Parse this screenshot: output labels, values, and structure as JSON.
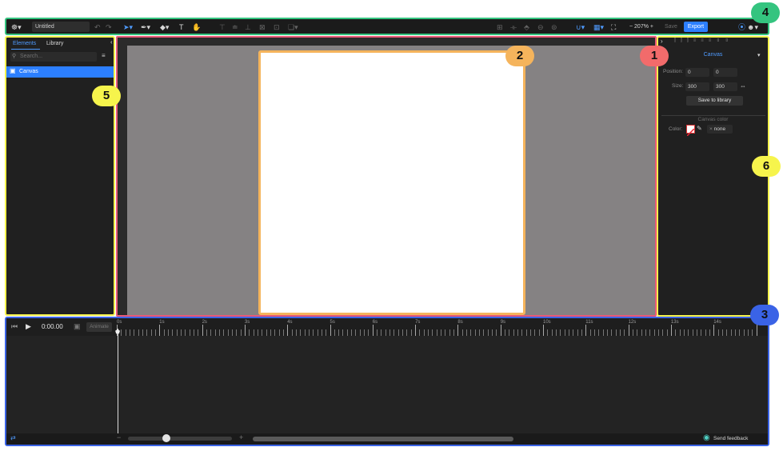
{
  "toolbar": {
    "doc_name": "Untitled",
    "save_label": "Save",
    "export_label": "Export",
    "zoom": "~ 207% +"
  },
  "left_panel": {
    "tab_elements": "Elements",
    "tab_library": "Library",
    "search_placeholder": "Search...",
    "items": [
      "Canvas"
    ]
  },
  "right_panel": {
    "title": "Canvas",
    "position_label": "Position:",
    "position_x": "0",
    "position_y": "0",
    "size_label": "Size:",
    "size_w": "300",
    "size_h": "300",
    "save_library": "Save to library",
    "section_title": "Canvas color",
    "color_label": "Color:",
    "color_value": "none"
  },
  "timeline": {
    "time": "0:00.00",
    "animate": "Animate",
    "labels": [
      "0s",
      "1s",
      "2s",
      "3s",
      "4s",
      "5s",
      "6s",
      "7s",
      "8s",
      "9s",
      "10s",
      "11s",
      "12s",
      "13s",
      "14s"
    ],
    "feedback": "Send feedback"
  },
  "badges": [
    "1",
    "2",
    "3",
    "4",
    "5",
    "6"
  ],
  "colors": {
    "toolbar_border": "#34c47f",
    "panel_border": "#f6f44c",
    "stage_border": "#e85a78",
    "timeline_border": "#3a63e6",
    "accent": "#2c7fff",
    "badge1": "#f26b6b",
    "badge2": "#f5b45c",
    "badge3": "#3a63e6",
    "badge4": "#34c47f",
    "badge5": "#f6f44c",
    "badge6": "#f6f44c"
  }
}
